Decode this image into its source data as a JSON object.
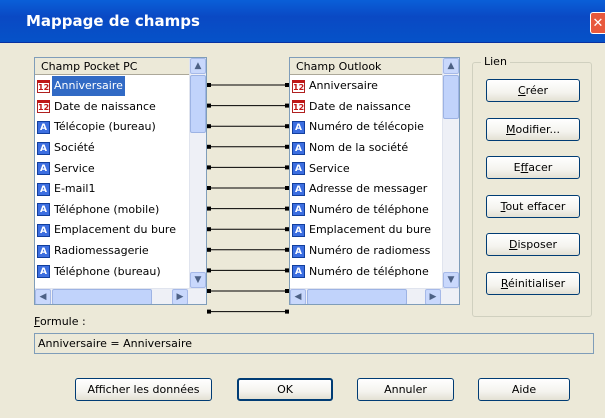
{
  "window": {
    "title": "Mappage de champs",
    "close_glyph": "✕"
  },
  "left_list": {
    "header": "Champ Pocket PC",
    "items": [
      {
        "label": "Anniversaire",
        "icon": "calendar-field-icon",
        "selected": true
      },
      {
        "label": "Date de naissance",
        "icon": "calendar-field-icon"
      },
      {
        "label": "Télécopie (bureau)",
        "icon": "text-field-icon"
      },
      {
        "label": "Société",
        "icon": "text-field-icon"
      },
      {
        "label": "Service",
        "icon": "text-field-icon"
      },
      {
        "label": "E-mail1",
        "icon": "text-field-icon"
      },
      {
        "label": "Téléphone (mobile)",
        "icon": "text-field-icon"
      },
      {
        "label": "Emplacement du bure",
        "icon": "text-field-icon"
      },
      {
        "label": "Radiomessagerie",
        "icon": "text-field-icon"
      },
      {
        "label": "Téléphone (bureau)",
        "icon": "text-field-icon"
      }
    ]
  },
  "right_list": {
    "header": "Champ Outlook",
    "items": [
      {
        "label": "Anniversaire",
        "icon": "calendar-field-icon"
      },
      {
        "label": "Date de naissance",
        "icon": "calendar-field-icon"
      },
      {
        "label": "Numéro de télécopie",
        "icon": "text-field-icon"
      },
      {
        "label": "Nom de la société",
        "icon": "text-field-icon"
      },
      {
        "label": "Service",
        "icon": "text-field-icon"
      },
      {
        "label": "Adresse de messager",
        "icon": "text-field-icon"
      },
      {
        "label": "Numéro de téléphone",
        "icon": "text-field-icon"
      },
      {
        "label": "Emplacement du bure",
        "icon": "text-field-icon"
      },
      {
        "label": "Numéro de radiomess",
        "icon": "text-field-icon"
      },
      {
        "label": "Numéro de téléphone",
        "icon": "text-field-icon"
      }
    ]
  },
  "link_group": {
    "label": "Lien",
    "buttons": [
      {
        "label": "Créer",
        "accel_index": 0
      },
      {
        "label": "Modifier...",
        "accel_index": 0
      },
      {
        "label": "Effacer",
        "accel_index": 1
      },
      {
        "label": "Tout effacer",
        "accel_index": 0
      },
      {
        "label": "Disposer",
        "accel_index": 0
      },
      {
        "label": "Réinitialiser",
        "accel_index": 0
      }
    ]
  },
  "formula": {
    "label": "Formule :",
    "value": "Anniversaire = Anniversaire"
  },
  "footer": {
    "buttons": [
      {
        "label": "Afficher les données"
      },
      {
        "label": "OK"
      },
      {
        "label": "Annuler"
      },
      {
        "label": "Aide"
      }
    ]
  },
  "colors": {
    "title_bar": "#0a49c4",
    "selection": "#316ac5",
    "close_button": "#e8593d"
  }
}
